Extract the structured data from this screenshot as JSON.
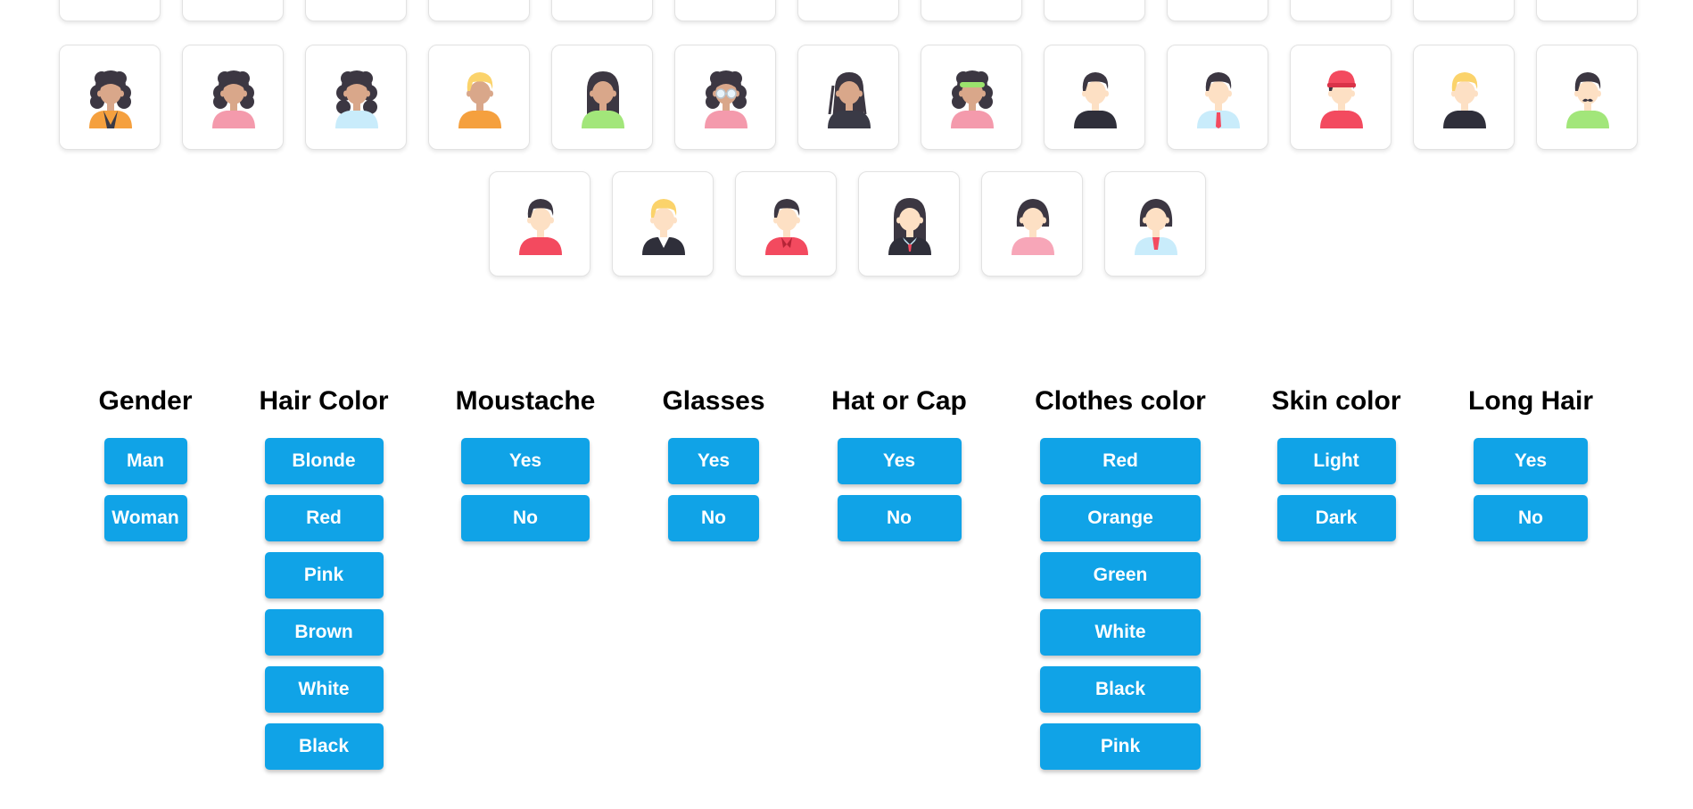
{
  "avatars": {
    "top_partial_row": [
      {
        "name": "avatar-partial-1"
      },
      {
        "name": "avatar-partial-2"
      },
      {
        "name": "avatar-partial-3"
      },
      {
        "name": "avatar-partial-4"
      },
      {
        "name": "avatar-partial-5"
      },
      {
        "name": "avatar-partial-6"
      },
      {
        "name": "avatar-partial-7"
      },
      {
        "name": "avatar-partial-8"
      },
      {
        "name": "avatar-partial-9"
      },
      {
        "name": "avatar-partial-10"
      },
      {
        "name": "avatar-partial-11"
      },
      {
        "name": "avatar-partial-12"
      },
      {
        "name": "avatar-partial-13"
      }
    ],
    "row_2": [
      {
        "gender": "woman",
        "hair": "curly",
        "hair_color": "#3c3742",
        "skin": "#d9a78a",
        "clothes": "#f5a03e",
        "extra": "dark-jacket"
      },
      {
        "gender": "woman",
        "hair": "curly",
        "hair_color": "#3c3742",
        "skin": "#d9a78a",
        "clothes": "#f49aac",
        "extra": ""
      },
      {
        "gender": "woman",
        "hair": "curly-long",
        "hair_color": "#3c3742",
        "skin": "#d9a78a",
        "clothes": "#c9ecfb",
        "extra": ""
      },
      {
        "gender": "man",
        "hair": "short",
        "hair_color": "#fbd36b",
        "skin": "#d9a78a",
        "clothes": "#f5a03e",
        "extra": ""
      },
      {
        "gender": "woman",
        "hair": "long-straight",
        "hair_color": "#3c3742",
        "skin": "#d9a78a",
        "clothes": "#a2e67a",
        "extra": ""
      },
      {
        "gender": "woman",
        "hair": "curly",
        "hair_color": "#3c3742",
        "skin": "#d9a78a",
        "clothes": "#f49aac",
        "extra": "glasses"
      },
      {
        "gender": "woman",
        "hair": "dreads",
        "hair_color": "#3c3742",
        "skin": "#d9a78a",
        "clothes": "#3a3a46",
        "extra": ""
      },
      {
        "gender": "woman",
        "hair": "curly",
        "hair_color": "#3c3742",
        "skin": "#d9a78a",
        "clothes": "#f49aac",
        "extra": "green-band"
      },
      {
        "gender": "man",
        "hair": "short",
        "hair_color": "#3c3742",
        "skin": "#fde0c4",
        "clothes": "#2f2f3a",
        "extra": ""
      },
      {
        "gender": "man",
        "hair": "short",
        "hair_color": "#3c3742",
        "skin": "#fde0c4",
        "clothes": "#c9ecfb",
        "extra": "red-tie"
      },
      {
        "gender": "man",
        "hair": "short",
        "hair_color": "#3c3742",
        "skin": "#fde0c4",
        "clothes": "#f34a5f",
        "extra": "red-cap"
      },
      {
        "gender": "man",
        "hair": "short",
        "hair_color": "#fbd36b",
        "skin": "#fde0c4",
        "clothes": "#2f2f3a",
        "extra": ""
      },
      {
        "gender": "man",
        "hair": "short",
        "hair_color": "#3c3742",
        "skin": "#fde0c4",
        "clothes": "#a2e67a",
        "extra": "moustache"
      }
    ],
    "row_3": [
      {
        "gender": "man",
        "hair": "short",
        "hair_color": "#3c3742",
        "skin": "#fde0c4",
        "clothes": "#f34a5f",
        "extra": ""
      },
      {
        "gender": "man",
        "hair": "short",
        "hair_color": "#fbd36b",
        "skin": "#fde0c4",
        "clothes": "#2f2f3a",
        "extra": "white-shirt"
      },
      {
        "gender": "man",
        "hair": "short",
        "hair_color": "#3c3742",
        "skin": "#fde0c4",
        "clothes": "#f34a5f",
        "extra": "collar"
      },
      {
        "gender": "woman",
        "hair": "long-straight",
        "hair_color": "#3c3742",
        "skin": "#fde0c4",
        "clothes": "#2f2f3a",
        "extra": "white-collar"
      },
      {
        "gender": "woman",
        "hair": "bob",
        "hair_color": "#3c3742",
        "skin": "#fde0c4",
        "clothes": "#f7a6b8",
        "extra": ""
      },
      {
        "gender": "woman",
        "hair": "bob",
        "hair_color": "#3c3742",
        "skin": "#fde0c4",
        "clothes": "#c9ecfb",
        "extra": "red-inner"
      }
    ]
  },
  "filters": [
    {
      "title": "Gender",
      "options": [
        "Man",
        "Woman"
      ]
    },
    {
      "title": "Hair Color",
      "options": [
        "Blonde",
        "Red",
        "Pink",
        "Brown",
        "White",
        "Black"
      ]
    },
    {
      "title": "Moustache",
      "options": [
        "Yes",
        "No"
      ]
    },
    {
      "title": "Glasses",
      "options": [
        "Yes",
        "No"
      ]
    },
    {
      "title": "Hat or Cap",
      "options": [
        "Yes",
        "No"
      ]
    },
    {
      "title": "Clothes color",
      "options": [
        "Red",
        "Orange",
        "Green",
        "White",
        "Black",
        "Pink"
      ]
    },
    {
      "title": "Skin color",
      "options": [
        "Light",
        "Dark"
      ]
    },
    {
      "title": "Long Hair",
      "options": [
        "Yes",
        "No"
      ]
    }
  ],
  "colors": {
    "button_bg": "#10a3e7",
    "button_text": "#ffffff",
    "card_border": "#e2e2e2"
  }
}
